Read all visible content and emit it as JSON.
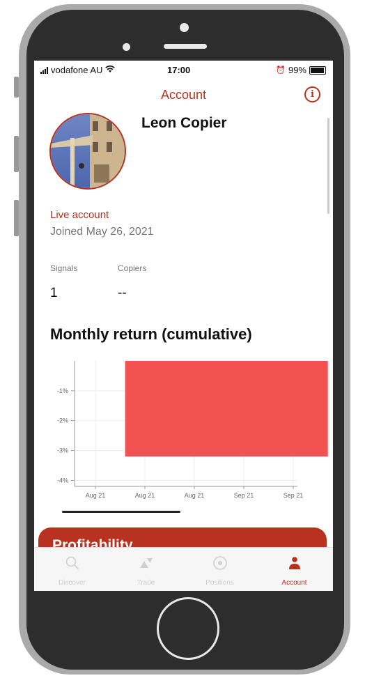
{
  "status_bar": {
    "carrier": "vodafone AU",
    "time": "17:00",
    "battery": "99%"
  },
  "header": {
    "title": "Account",
    "info_icon": "info-icon"
  },
  "profile": {
    "name": "Leon Copier",
    "account_type": "Live account",
    "joined": "Joined May 26, 2021"
  },
  "stats": {
    "signals_label": "Signals",
    "signals_value": "1",
    "copiers_label": "Copiers",
    "copiers_value": "--"
  },
  "section_title": "Monthly return (cumulative)",
  "chart_data": {
    "type": "bar",
    "y_ticks": [
      "-1%",
      "-2%",
      "-3%",
      "-4%"
    ],
    "x_ticks": [
      "Aug 21",
      "Aug 21",
      "Aug 21",
      "Sep 21",
      "Sep 21"
    ],
    "bar": {
      "from": 0.0,
      "to": -3.2,
      "x_start_index": 0.6,
      "x_end_index": 4.7
    },
    "ylim": [
      -4.2,
      0.0
    ],
    "bar_color": "#f25252"
  },
  "profitability_card": {
    "title": "Profitability"
  },
  "tab_bar": {
    "tabs": [
      {
        "label": "Discover",
        "icon": "search-icon"
      },
      {
        "label": "Trade",
        "icon": "trade-icon"
      },
      {
        "label": "Positions",
        "icon": "positions-icon"
      },
      {
        "label": "Account",
        "icon": "person-icon"
      }
    ]
  },
  "colors": {
    "accent": "#b9321f",
    "bar": "#f25252"
  }
}
